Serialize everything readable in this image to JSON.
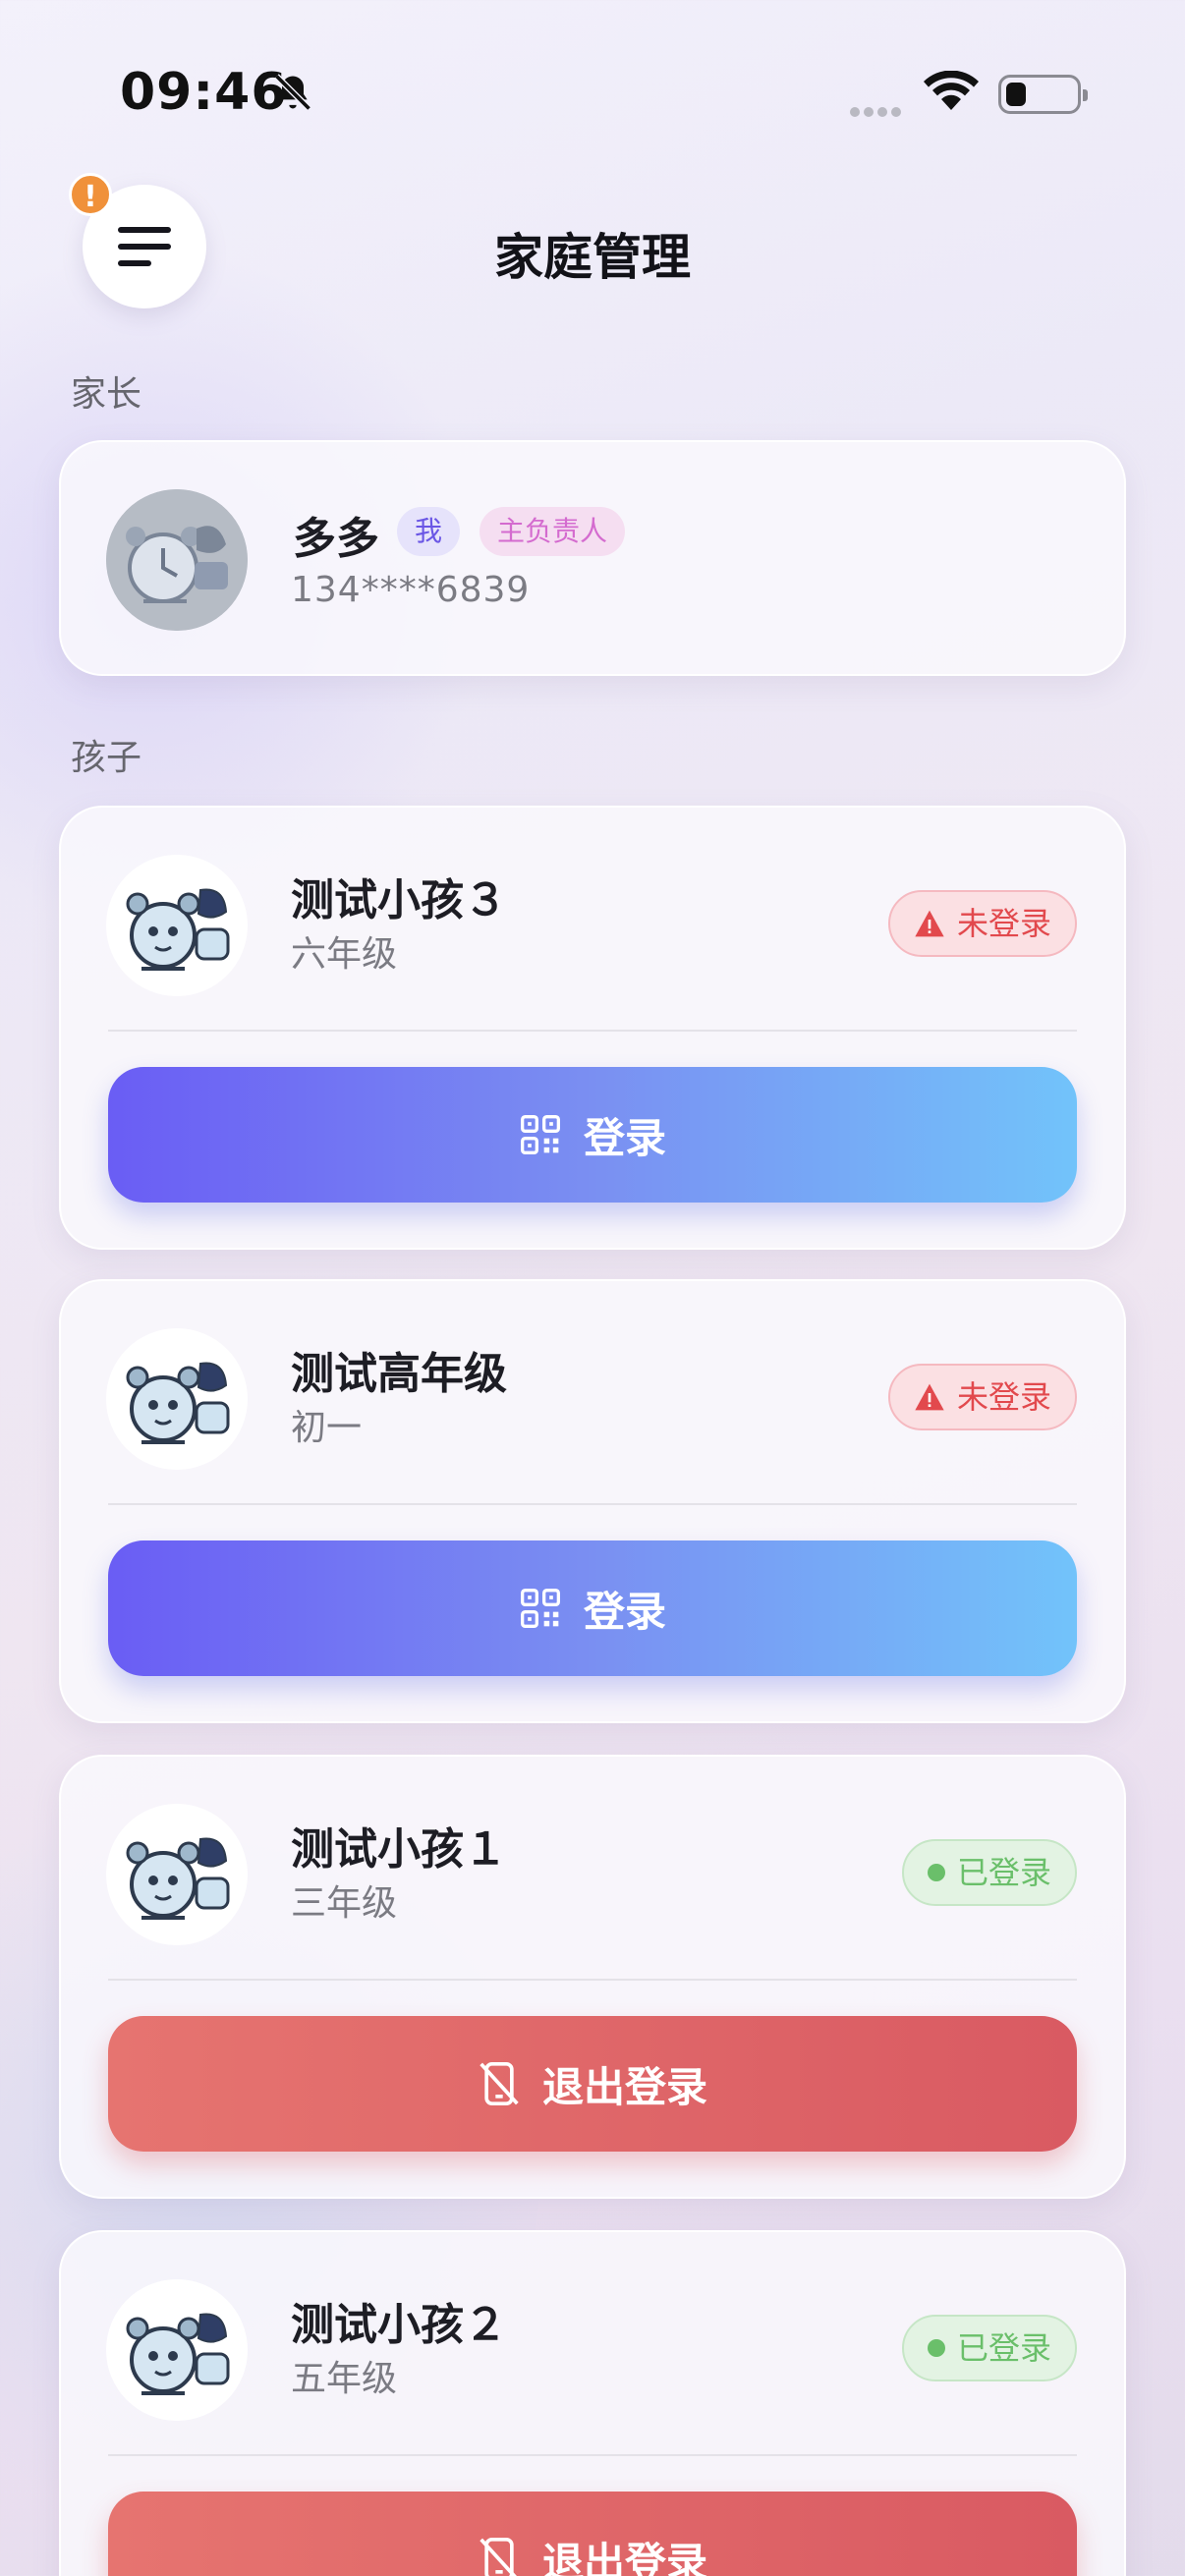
{
  "status_bar": {
    "time": "09:46",
    "bell_icon": "bell-muted-icon",
    "wifi_icon": "wifi-icon",
    "battery_icon": "battery-icon",
    "battery_level": 0.25
  },
  "header": {
    "title": "家庭管理",
    "menu_icon": "menu-icon",
    "alert_badge": "!"
  },
  "sections": {
    "parents_label": "家长",
    "children_label": "孩子"
  },
  "parent": {
    "name": "多多",
    "tag_me": "我",
    "tag_role": "主负责人",
    "phone": "134****6839"
  },
  "children": [
    {
      "name": "测试小孩３",
      "grade": "六年级",
      "status": "未登录",
      "status_type": "logged-out",
      "action": "登录",
      "action_icon": "qr-code-icon"
    },
    {
      "name": "测试高年级",
      "grade": "初一",
      "status": "未登录",
      "status_type": "logged-out",
      "action": "登录",
      "action_icon": "qr-code-icon"
    },
    {
      "name": "测试小孩１",
      "grade": "三年级",
      "status": "已登录",
      "status_type": "logged-in",
      "action": "退出登录",
      "action_icon": "phone-off-icon"
    },
    {
      "name": "测试小孩２",
      "grade": "五年级",
      "status": "已登录",
      "status_type": "logged-in",
      "action": "退出登录",
      "action_icon": "phone-off-icon"
    }
  ],
  "colors": {
    "accent_purple": "#6a5df4",
    "accent_blue": "#72c3fa",
    "danger_red": "#d95a62",
    "success_green": "#6abf6a"
  }
}
